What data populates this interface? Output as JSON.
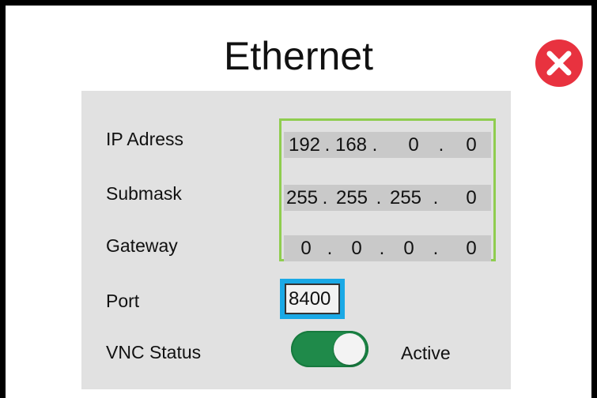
{
  "window": {
    "title": "Ethernet"
  },
  "icons": {
    "close": "close-circle-icon"
  },
  "colors": {
    "close": "#e8323f",
    "panel": "#e1e1e1",
    "ip_group_border": "#8fcd4f",
    "port_highlight": "#1aa9e6",
    "toggle_on": "#1f8a4a"
  },
  "fields": {
    "ip_address": {
      "label": "IP Adress",
      "octets": [
        "192",
        "168",
        "0",
        "0"
      ]
    },
    "submask": {
      "label": "Submask",
      "octets": [
        "255",
        "255",
        "255",
        "0"
      ]
    },
    "gateway": {
      "label": "Gateway",
      "octets": [
        "0",
        "0",
        "0",
        "0"
      ]
    },
    "port": {
      "label": "Port",
      "value": "8400"
    },
    "vnc_status": {
      "label": "VNC Status",
      "enabled": true,
      "state_text": "Active"
    }
  },
  "separator": "."
}
